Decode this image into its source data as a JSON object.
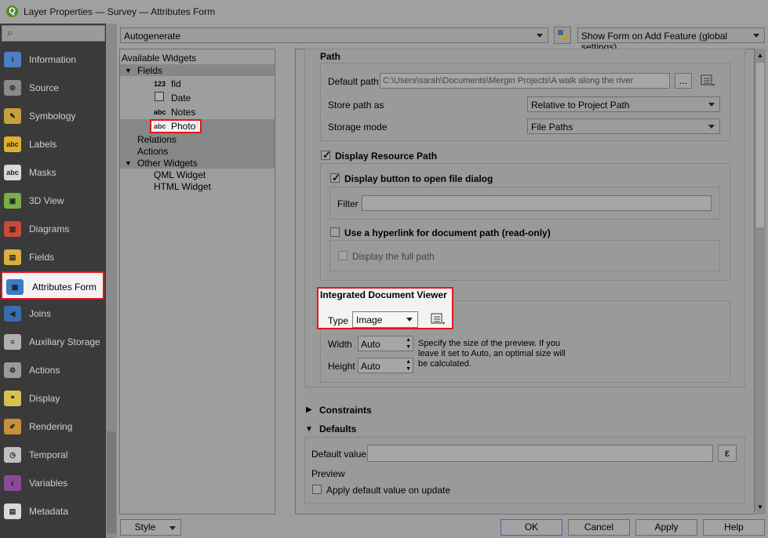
{
  "window": {
    "title": "Layer Properties — Survey — Attributes Form",
    "app_icon_letter": "Q"
  },
  "sidebar": {
    "search_icon": "search-icon",
    "items": [
      {
        "label": "Information",
        "icon": "info-icon",
        "color": "#4a7fc1"
      },
      {
        "label": "Source",
        "icon": "gear-wrench-icon",
        "color": "#8a8a8a"
      },
      {
        "label": "Symbology",
        "icon": "brush-icon",
        "color": "#c8a03a"
      },
      {
        "label": "Labels",
        "icon": "abc-label-icon",
        "color": "#e0b030"
      },
      {
        "label": "Masks",
        "icon": "abc-mask-icon",
        "color": "#d8d8d8"
      },
      {
        "label": "3D View",
        "icon": "cube-icon",
        "color": "#7ab04a"
      },
      {
        "label": "Diagrams",
        "icon": "diagram-icon",
        "color": "#c84a3a"
      },
      {
        "label": "Fields",
        "icon": "table-icon",
        "color": "#d8b040"
      },
      {
        "label": "Attributes Form",
        "icon": "form-icon",
        "color": "#3a7ac8"
      },
      {
        "label": "Joins",
        "icon": "join-icon",
        "color": "#3a6ab0"
      },
      {
        "label": "Auxiliary Storage",
        "icon": "database-icon",
        "color": "#b0b0b0"
      },
      {
        "label": "Actions",
        "icon": "gear-icon",
        "color": "#9a9a9a"
      },
      {
        "label": "Display",
        "icon": "speech-bubble-icon",
        "color": "#d8c050"
      },
      {
        "label": "Rendering",
        "icon": "paintbrush-icon",
        "color": "#c8903a"
      },
      {
        "label": "Temporal",
        "icon": "clock-icon",
        "color": "#c0c0c0"
      },
      {
        "label": "Variables",
        "icon": "epsilon-icon",
        "color": "#8a4a9a"
      },
      {
        "label": "Metadata",
        "icon": "metadata-icon",
        "color": "#d8d8d8"
      }
    ]
  },
  "toolbar": {
    "layout_combo": "Autogenerate",
    "python_icon": "python-icon",
    "show_form_combo": "Show Form on Add Feature (global settings)"
  },
  "tree": {
    "root": "Available Widgets",
    "fields_label": "Fields",
    "fields": [
      {
        "type": "123",
        "name": "fid"
      },
      {
        "type": "date",
        "name": "Date"
      },
      {
        "type": "abc",
        "name": "Notes"
      },
      {
        "type": "abc",
        "name": "Photo"
      }
    ],
    "relations": "Relations",
    "actions": "Actions",
    "other_widgets": "Other Widgets",
    "other_items": [
      "QML Widget",
      "HTML Widget"
    ]
  },
  "path": {
    "title": "Path",
    "default_path_label": "Default path",
    "default_path_value": "C:\\Users\\sarah\\Documents\\Mergin Projects\\A walk along the river",
    "browse_label": "...",
    "store_path_label": "Store path as",
    "store_path_value": "Relative to Project Path",
    "storage_mode_label": "Storage mode",
    "storage_mode_value": "File Paths"
  },
  "resource": {
    "display_resource_path": "Display Resource Path",
    "display_button": "Display button to open file dialog",
    "filter_label": "Filter",
    "filter_value": "",
    "hyperlink": "Use a hyperlink for document path (read-only)",
    "full_path": "Display the full path"
  },
  "viewer": {
    "title": "Integrated Document Viewer",
    "type_label": "Type",
    "type_value": "Image",
    "width_label": "Width",
    "width_value": "Auto",
    "height_label": "Height",
    "height_value": "Auto",
    "hint": "Specify the size of the preview. If you leave it set to Auto, an optimal size will be calculated.",
    "hint_lines": [
      "Specify the size of the preview. If you",
      "leave it set to Auto, an optimal size will",
      "be calculated."
    ]
  },
  "constraints": {
    "label": "Constraints"
  },
  "defaults": {
    "label": "Defaults",
    "default_value_label": "Default value",
    "default_value": "",
    "epsilon": "ε",
    "preview_label": "Preview",
    "apply_on_update": "Apply default value on update"
  },
  "footer": {
    "style": "Style",
    "ok": "OK",
    "cancel": "Cancel",
    "apply": "Apply",
    "help": "Help"
  },
  "colors": {
    "highlight": "#e8141a"
  }
}
